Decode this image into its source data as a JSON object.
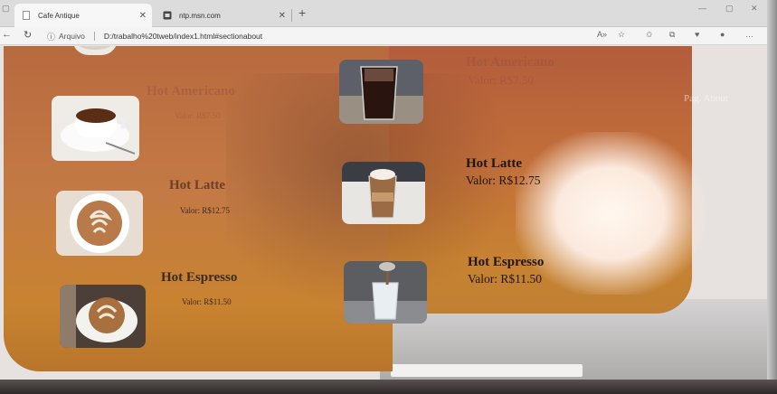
{
  "browser": {
    "tabs": [
      {
        "title": "Cafe Antique",
        "active": true
      },
      {
        "title": "ntp.msn.com",
        "active": false
      }
    ],
    "address": {
      "label": "Arquivo",
      "url": "D:/trabalho%20tweb/index1.html#sectionabout"
    },
    "tool_icons": [
      "read-aloud-icon",
      "favorite-add-icon",
      "favorites-icon",
      "collections-icon",
      "heart-icon",
      "profile-icon",
      "more-icon"
    ]
  },
  "page": {
    "nav_link": "Pag. About",
    "menu_left": [
      {
        "name": "Hot Americano",
        "price": "Valor: R$7.50"
      },
      {
        "name": "Hot Latte",
        "price": "Valor: R$12.75"
      },
      {
        "name": "Hot Espresso",
        "price": "Valor: R$11.50"
      }
    ],
    "menu_right": [
      {
        "name": "Hot Americano",
        "price": "Valor: R$7.50"
      },
      {
        "name": "Hot Latte",
        "price": "Valor: R$12.75"
      },
      {
        "name": "Hot Espresso",
        "price": "Valor: R$11.50"
      }
    ]
  },
  "colors": {
    "panel_top": "#b86a3f",
    "panel_bottom": "#c88330",
    "text_dark": "#1e1610"
  }
}
